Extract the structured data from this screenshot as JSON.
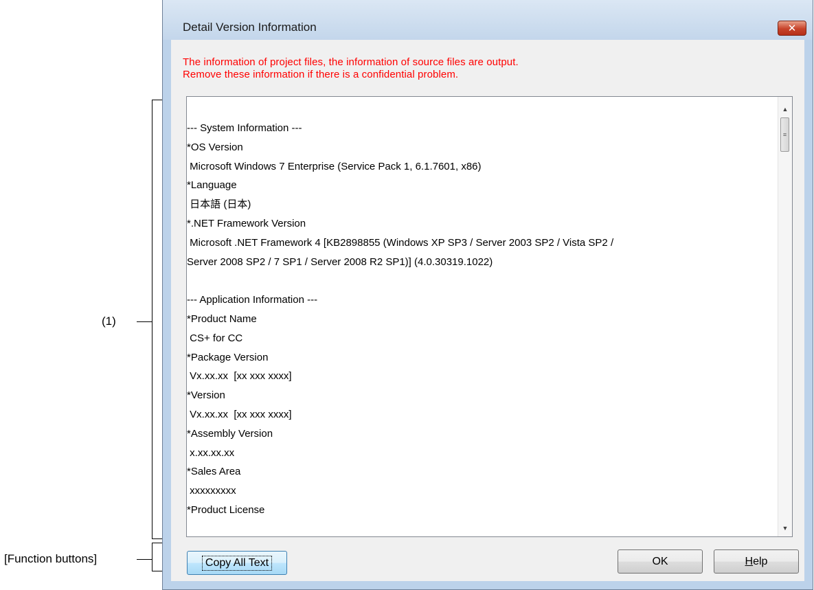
{
  "annotations": {
    "area_label": "(1)",
    "buttons_label": "[Function buttons]"
  },
  "dialog": {
    "title": "Detail Version Information",
    "close_glyph": "✕",
    "notice_lines": [
      "The information of project files, the information of source files are output.",
      "Remove these information if there is a confidential problem."
    ],
    "text_lines": [
      "",
      "--- System Information ---",
      "*OS Version",
      " Microsoft Windows 7 Enterprise (Service Pack 1, 6.1.7601, x86)",
      "*Language",
      " 日本語 (日本)",
      "*.NET Framework Version",
      " Microsoft .NET Framework 4 [KB2898855 (Windows XP SP3 / Server 2003 SP2 / Vista SP2 /",
      "Server 2008 SP2 / 7 SP1 / Server 2008 R2 SP1)] (4.0.30319.1022)",
      "",
      "--- Application Information ---",
      "*Product Name",
      " CS+ for CC",
      "*Package Version",
      " Vx.xx.xx  [xx xxx xxxx]",
      "*Version",
      " Vx.xx.xx  [xx xxx xxxx]",
      "*Assembly Version",
      " x.xx.xx.xx",
      "*Sales Area",
      " xxxxxxxxx",
      "*Product License"
    ],
    "buttons": {
      "copy_all_text": "Copy All Text",
      "ok": "OK",
      "help_prefix": "H",
      "help_rest": "elp"
    }
  },
  "icons": {
    "scroll_up": "scroll-up-arrow",
    "scroll_down": "scroll-down-arrow",
    "thumb_grip": "grip"
  },
  "colors": {
    "notice": "#ff0000",
    "window_frame": "#bcd2ea",
    "close_button": "#c7432a"
  }
}
